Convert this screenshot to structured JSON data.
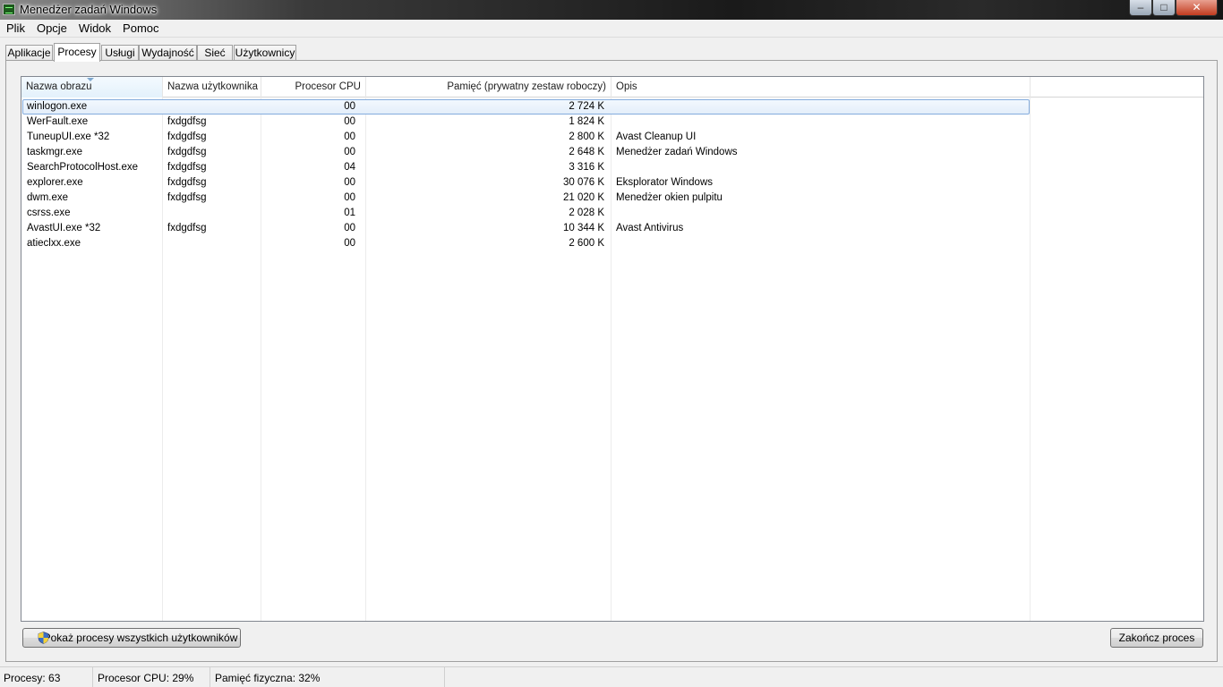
{
  "window": {
    "title": "Menedżer zadań Windows",
    "controls": {
      "minimize": "–",
      "maximize": "□",
      "close": "✕"
    }
  },
  "menu": [
    "Plik",
    "Opcje",
    "Widok",
    "Pomoc"
  ],
  "tabs": [
    {
      "label": "Aplikacje",
      "active": false
    },
    {
      "label": "Procesy",
      "active": true
    },
    {
      "label": "Usługi",
      "active": false
    },
    {
      "label": "Wydajność",
      "active": false
    },
    {
      "label": "Sieć",
      "active": false
    },
    {
      "label": "Użytkownicy",
      "active": false
    }
  ],
  "table": {
    "columns": [
      "Nazwa obrazu",
      "Nazwa użytkownika",
      "Procesor CPU",
      "Pamięć (prywatny zestaw roboczy)",
      "Opis"
    ],
    "sorted_column": "Nazwa obrazu",
    "rows": [
      {
        "name": "winlogon.exe",
        "user": "",
        "cpu": "00",
        "mem": "2 724 K",
        "desc": "",
        "selected": true
      },
      {
        "name": "WerFault.exe",
        "user": "fxdgdfsg",
        "cpu": "00",
        "mem": "1 824 K",
        "desc": ""
      },
      {
        "name": "TuneupUI.exe *32",
        "user": "fxdgdfsg",
        "cpu": "00",
        "mem": "2 800 K",
        "desc": "Avast Cleanup UI"
      },
      {
        "name": "taskmgr.exe",
        "user": "fxdgdfsg",
        "cpu": "00",
        "mem": "2 648 K",
        "desc": "Menedżer zadań Windows"
      },
      {
        "name": "SearchProtocolHost.exe",
        "user": "fxdgdfsg",
        "cpu": "04",
        "mem": "3 316 K",
        "desc": ""
      },
      {
        "name": "explorer.exe",
        "user": "fxdgdfsg",
        "cpu": "00",
        "mem": "30 076 K",
        "desc": "Eksplorator Windows"
      },
      {
        "name": "dwm.exe",
        "user": "fxdgdfsg",
        "cpu": "00",
        "mem": "21 020 K",
        "desc": "Menedżer okien pulpitu"
      },
      {
        "name": "csrss.exe",
        "user": "",
        "cpu": "01",
        "mem": "2 028 K",
        "desc": ""
      },
      {
        "name": "AvastUI.exe *32",
        "user": "fxdgdfsg",
        "cpu": "00",
        "mem": "10 344 K",
        "desc": "Avast Antivirus"
      },
      {
        "name": "atieclxx.exe",
        "user": "",
        "cpu": "00",
        "mem": "2 600 K",
        "desc": ""
      }
    ]
  },
  "buttons": {
    "show_all": "Pokaż procesy wszystkich użytkowników",
    "end_process": "Zakończ proces"
  },
  "status": {
    "processes": "Procesy: 63",
    "cpu": "Procesor CPU: 29%",
    "memory": "Pamięć fizyczna: 32%"
  },
  "icons": {
    "app": "task-manager-icon",
    "shield": "uac-shield-icon"
  }
}
